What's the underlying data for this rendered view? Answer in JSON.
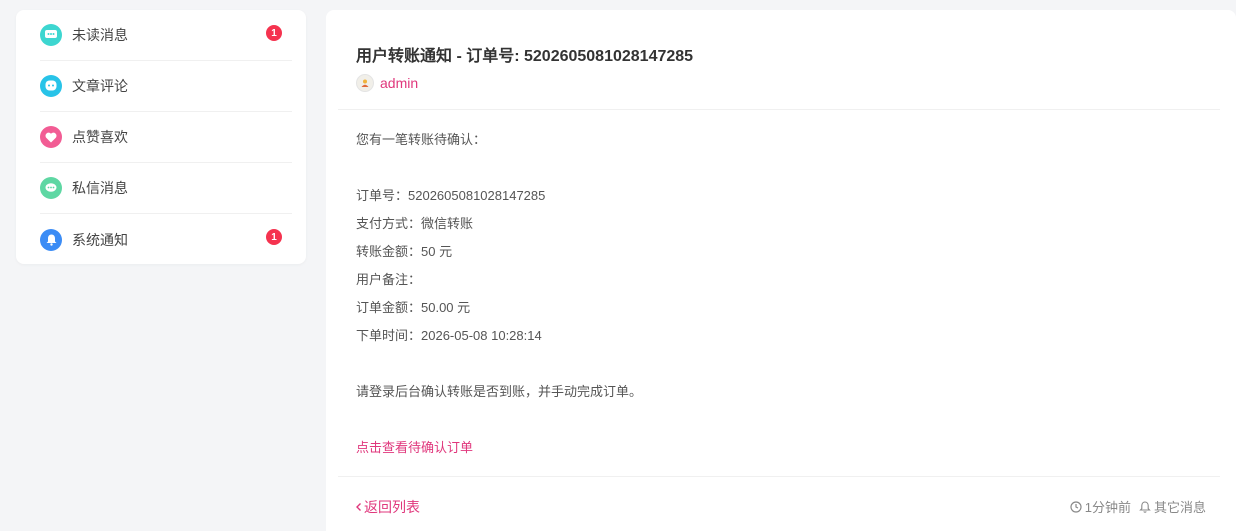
{
  "colors": {
    "accent": "#e0377c",
    "badge": "#f5334f",
    "unread_icon": "#3dd6d0",
    "comment_icon": "#28c3e8",
    "like_icon": "#f25c94",
    "message_icon": "#5ed7a3",
    "system_icon": "#3b8cf5"
  },
  "sidebar": {
    "items": [
      {
        "label": "未读消息",
        "icon": "message-dots-icon",
        "badge": "1"
      },
      {
        "label": "文章评论",
        "icon": "comment-icon",
        "badge": null
      },
      {
        "label": "点赞喜欢",
        "icon": "heart-icon",
        "badge": null
      },
      {
        "label": "私信消息",
        "icon": "chat-icon",
        "badge": null
      },
      {
        "label": "系统通知",
        "icon": "bell-icon",
        "badge": "1"
      }
    ]
  },
  "notice": {
    "title": "用户转账通知 - 订单号: 5202605081028147285",
    "author": "admin",
    "lines": [
      "您有一笔转账待确认：",
      "订单号：5202605081028147285",
      "支付方式：微信转账",
      "转账金额：50 元",
      "用户备注：",
      "订单金额：50.00 元",
      "下单时间：2026-05-08 10:28:14",
      "请登录后台确认转账是否到账，并手动完成订单。"
    ],
    "link": "点击查看待确认订单"
  },
  "footer": {
    "back": "返回列表",
    "time": "1分钟前",
    "other": "其它消息"
  }
}
